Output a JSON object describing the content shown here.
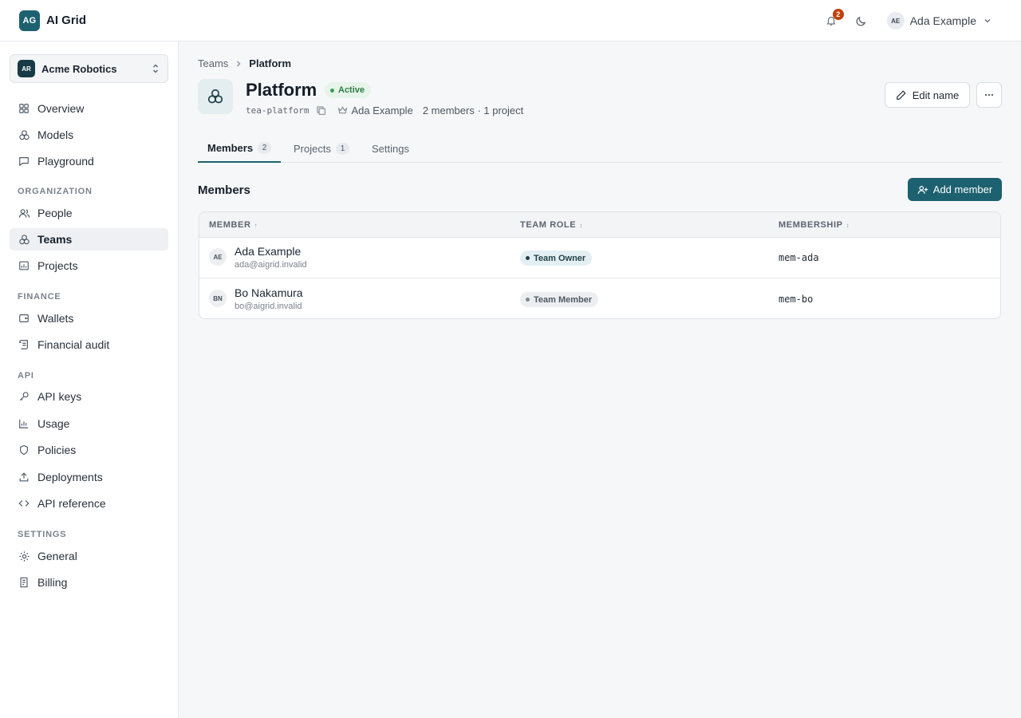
{
  "brand": {
    "logo": "AG",
    "name": "AI Grid",
    "accent": "#1d6170"
  },
  "topbar": {
    "notifications_count": "2",
    "theme_icon": "moon-icon",
    "user": {
      "initials": "AE",
      "name": "Ada Example"
    }
  },
  "sidebar": {
    "org": {
      "initials": "AR",
      "name": "Acme Robotics"
    },
    "items": [
      {
        "label": "Overview",
        "icon": "grid-icon"
      },
      {
        "label": "Models",
        "icon": "cubes-icon"
      },
      {
        "label": "Playground",
        "icon": "chat-icon"
      }
    ],
    "sections": {
      "organization": {
        "title": "ORGANIZATION",
        "items": [
          {
            "label": "People",
            "icon": "people-icon"
          },
          {
            "label": "Teams",
            "icon": "cubes-icon",
            "active": true
          },
          {
            "label": "Projects",
            "icon": "chart-icon"
          }
        ]
      },
      "finance": {
        "title": "FINANCE",
        "items": [
          {
            "label": "Wallets",
            "icon": "wallet-icon"
          },
          {
            "label": "Financial audit",
            "icon": "scroll-icon"
          }
        ]
      },
      "api": {
        "title": "API",
        "items": [
          {
            "label": "API keys",
            "icon": "key-icon"
          },
          {
            "label": "Usage",
            "icon": "bar-chart-icon"
          },
          {
            "label": "Policies",
            "icon": "shield-icon"
          },
          {
            "label": "Deployments",
            "icon": "upload-icon"
          },
          {
            "label": "API reference",
            "icon": "code-icon"
          }
        ]
      },
      "settings": {
        "title": "SETTINGS",
        "items": [
          {
            "label": "General",
            "icon": "gear-icon"
          },
          {
            "label": "Billing",
            "icon": "receipt-icon"
          }
        ]
      }
    }
  },
  "breadcrumb": {
    "parent": "Teams",
    "current": "Platform"
  },
  "team": {
    "name": "Platform",
    "status": "Active",
    "slug": "tea-platform",
    "owner": "Ada Example",
    "counts": "2 members · 1 project",
    "edit_label": "Edit name"
  },
  "tabs": [
    {
      "label": "Members",
      "count": "2",
      "active": true
    },
    {
      "label": "Projects",
      "count": "1"
    },
    {
      "label": "Settings"
    }
  ],
  "members_section": {
    "title": "Members",
    "add_label": "Add member",
    "columns": [
      "MEMBER",
      "TEAM ROLE",
      "MEMBERSHIP"
    ],
    "rows": [
      {
        "initials": "AE",
        "name": "Ada Example",
        "email": "ada@aigrid.invalid",
        "role": "Team Owner",
        "membership": "mem-ada"
      },
      {
        "initials": "BN",
        "name": "Bo Nakamura",
        "email": "bo@aigrid.invalid",
        "role": "Team Member",
        "membership": "mem-bo"
      }
    ]
  }
}
